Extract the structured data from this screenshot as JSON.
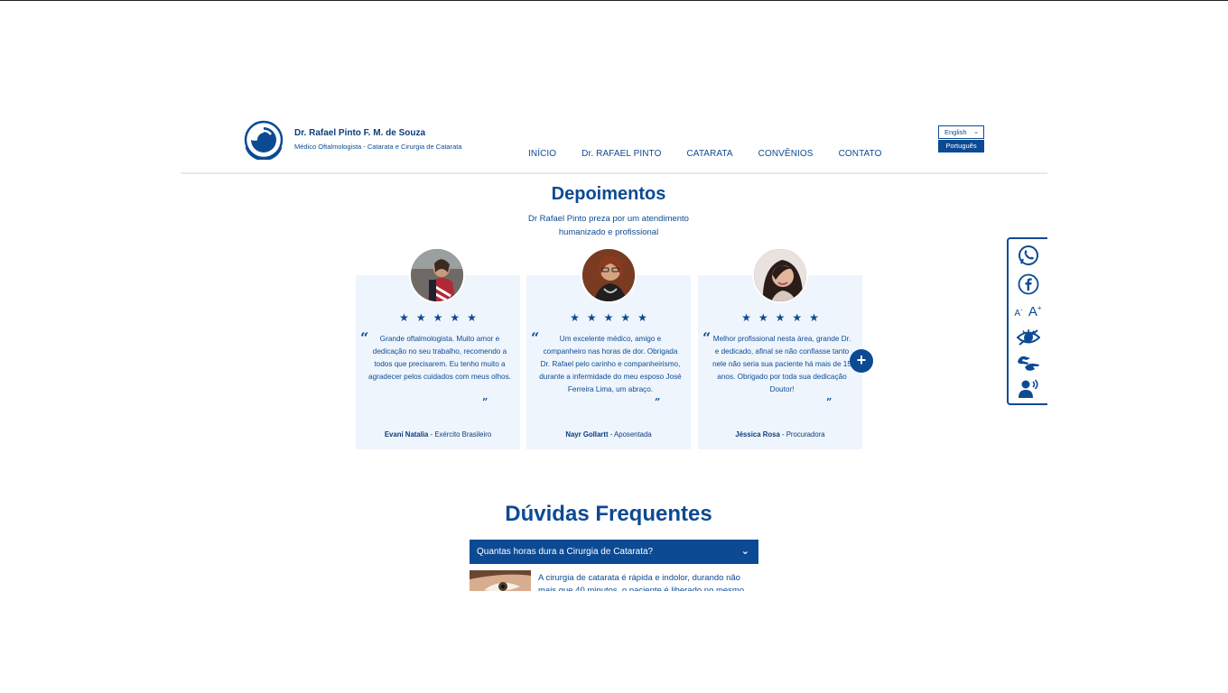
{
  "brand": {
    "name": "Dr. Rafael Pinto F. M. de Souza",
    "subtitle": "Médico Oftalmologista - Catarata e Cirurgia de Catarata"
  },
  "nav": [
    "INÍCIO",
    "Dr. RAFAEL PINTO",
    "CATARATA",
    "CONVÊNIOS",
    "CONTATO"
  ],
  "language": {
    "selected": "English",
    "option": "Português"
  },
  "testimonials": {
    "title": "Depoimentos",
    "subtitle": "Dr Rafael Pinto preza por um atendimento humanizado e profissional",
    "stars": "★★★★★",
    "items": [
      {
        "text": "Grande oftalmologista. Muito amor e dedicação no seu trabalho, recomendo a todos que precisarem. Eu tenho muito a agradecer pelos cuidados com meus olhos.",
        "name": "Evani Natalia",
        "role": "Exército Brasileiro"
      },
      {
        "text": "Um excelente médico, amigo e companheiro nas horas de dor. Obrigada Dr. Rafael pelo carinho e companheirismo, durante a infermidade do meu esposo José Ferreira Lima, um abraço.",
        "name": "Nayr Gollartt",
        "role": "Aposentada"
      },
      {
        "text": "Melhor profissional nesta área, grande Dr. e dedicado, afinal se não confiasse tanto nele não seria sua paciente há mais de 15 anos. Obrigado por toda sua dedicação Doutor!",
        "name": "Jéssica Rosa",
        "role": "Procuradora"
      }
    ],
    "more_label": "+"
  },
  "faq": {
    "title": "Dúvidas Frequentes",
    "question": "Quantas horas dura a Cirurgia de Catarata?",
    "answer": "A cirurgia de catarata é rápida e indolor, durando não mais que 40 minutos, o paciente é liberado no mesmo"
  },
  "toolbar": {
    "icons": [
      "whatsapp-icon",
      "facebook-icon",
      "font-size-icon",
      "low-vision-icon",
      "sign-language-icon",
      "audio-reader-icon"
    ],
    "font_small": "A",
    "font_large": "A",
    "font_minus": "-",
    "font_plus": "+"
  },
  "colors": {
    "primary": "#0c4a94",
    "card_bg": "#eff5fc",
    "header_border": "#e6e9ee"
  }
}
